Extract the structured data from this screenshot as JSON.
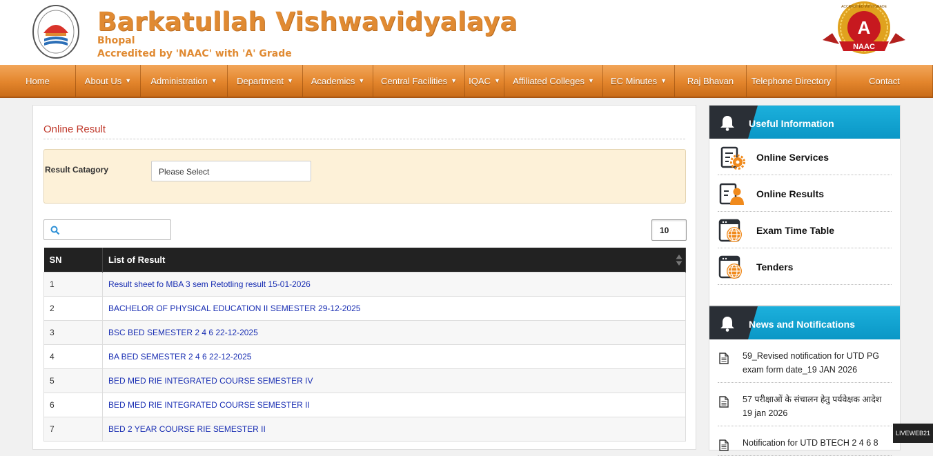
{
  "header": {
    "title": "Barkatullah Vishwavidyalaya",
    "city": "Bhopal",
    "accreditation": "Accredited by 'NAAC' with 'A' Grade",
    "naac_badge": {
      "grade": "A",
      "label": "NAAC",
      "ring_text": "ACCREDITED WITH GRADE"
    }
  },
  "nav": {
    "items": [
      {
        "label": "Home",
        "dropdown": false
      },
      {
        "label": "About Us",
        "dropdown": true
      },
      {
        "label": "Administration",
        "dropdown": true
      },
      {
        "label": "Department",
        "dropdown": true
      },
      {
        "label": "Academics",
        "dropdown": true
      },
      {
        "label": "Central Facilities",
        "dropdown": true
      },
      {
        "label": "IQAC",
        "dropdown": true
      },
      {
        "label": "Affiliated Colleges",
        "dropdown": true
      },
      {
        "label": "EC Minutes",
        "dropdown": true
      },
      {
        "label": "Raj Bhavan",
        "dropdown": false
      },
      {
        "label": "Telephone Directory",
        "dropdown": false
      },
      {
        "label": "Contact",
        "dropdown": false
      }
    ]
  },
  "main": {
    "section_title": "Online Result",
    "filter": {
      "label": "Result Catagory",
      "selected": "Please Select"
    },
    "search": {
      "placeholder": ""
    },
    "page_size": "10",
    "table": {
      "headers": [
        "SN",
        "List of Result"
      ],
      "rows": [
        {
          "sn": "1",
          "title": "Result sheet fo MBA 3 sem Retotling result 15-01-2026"
        },
        {
          "sn": "2",
          "title": "BACHELOR OF PHYSICAL EDUCATION II SEMESTER 29-12-2025"
        },
        {
          "sn": "3",
          "title": "BSC BED SEMESTER 2 4 6 22-12-2025"
        },
        {
          "sn": "4",
          "title": "BA BED SEMESTER 2 4 6 22-12-2025"
        },
        {
          "sn": "5",
          "title": "BED MED RIE INTEGRATED COURSE SEMESTER IV"
        },
        {
          "sn": "6",
          "title": "BED MED RIE INTEGRATED COURSE SEMESTER II"
        },
        {
          "sn": "7",
          "title": "BED 2 YEAR COURSE RIE SEMESTER II"
        }
      ]
    }
  },
  "sidebar": {
    "useful": {
      "title": "Useful Information",
      "items": [
        {
          "label": "Online Services",
          "icon": "services-gear-icon"
        },
        {
          "label": "Online Results",
          "icon": "results-person-icon"
        },
        {
          "label": "Exam Time Table",
          "icon": "globe-doc-icon"
        },
        {
          "label": "Tenders",
          "icon": "globe-doc-icon"
        }
      ]
    },
    "news": {
      "title": "News and Notifications",
      "items": [
        "59_Revised notification for UTD PG exam form date_19 JAN 2026",
        "57 परीक्षाओं के संचालन हेतु पर्यवेक्षक आदेश 19 jan 2026",
        "Notification for UTD BTECH 2 4 6 8"
      ]
    }
  },
  "badge": "LIVEWEB21",
  "colors": {
    "brand_orange": "#e08a32",
    "nav_orange": "#e3852c",
    "accent_blue": "#0a97c6",
    "link_blue": "#1a2fb3",
    "title_red": "#c0392b"
  }
}
